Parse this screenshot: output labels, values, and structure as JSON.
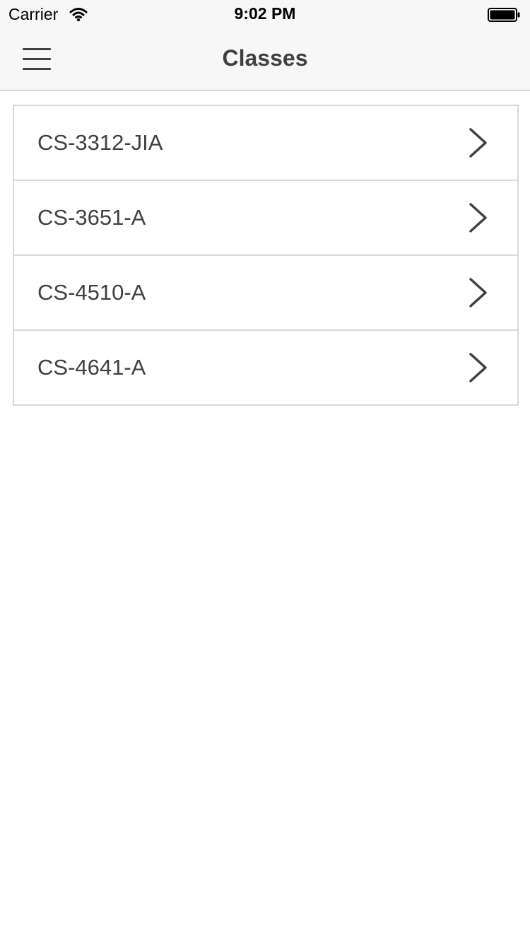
{
  "status_bar": {
    "carrier": "Carrier",
    "wifi_icon": "wifi-icon",
    "time": "9:02 PM",
    "battery_icon": "battery-icon"
  },
  "nav_bar": {
    "menu_icon": "hamburger-menu-icon",
    "title": "Classes"
  },
  "classes": [
    {
      "label": "CS-3312-JIA",
      "icon": "chevron-right-icon"
    },
    {
      "label": "CS-3651-A",
      "icon": "chevron-right-icon"
    },
    {
      "label": "CS-4510-A",
      "icon": "chevron-right-icon"
    },
    {
      "label": "CS-4641-A",
      "icon": "chevron-right-icon"
    }
  ],
  "colors": {
    "bar_background": "#f7f7f7",
    "text": "#404040",
    "divider": "#d9d9d9"
  }
}
